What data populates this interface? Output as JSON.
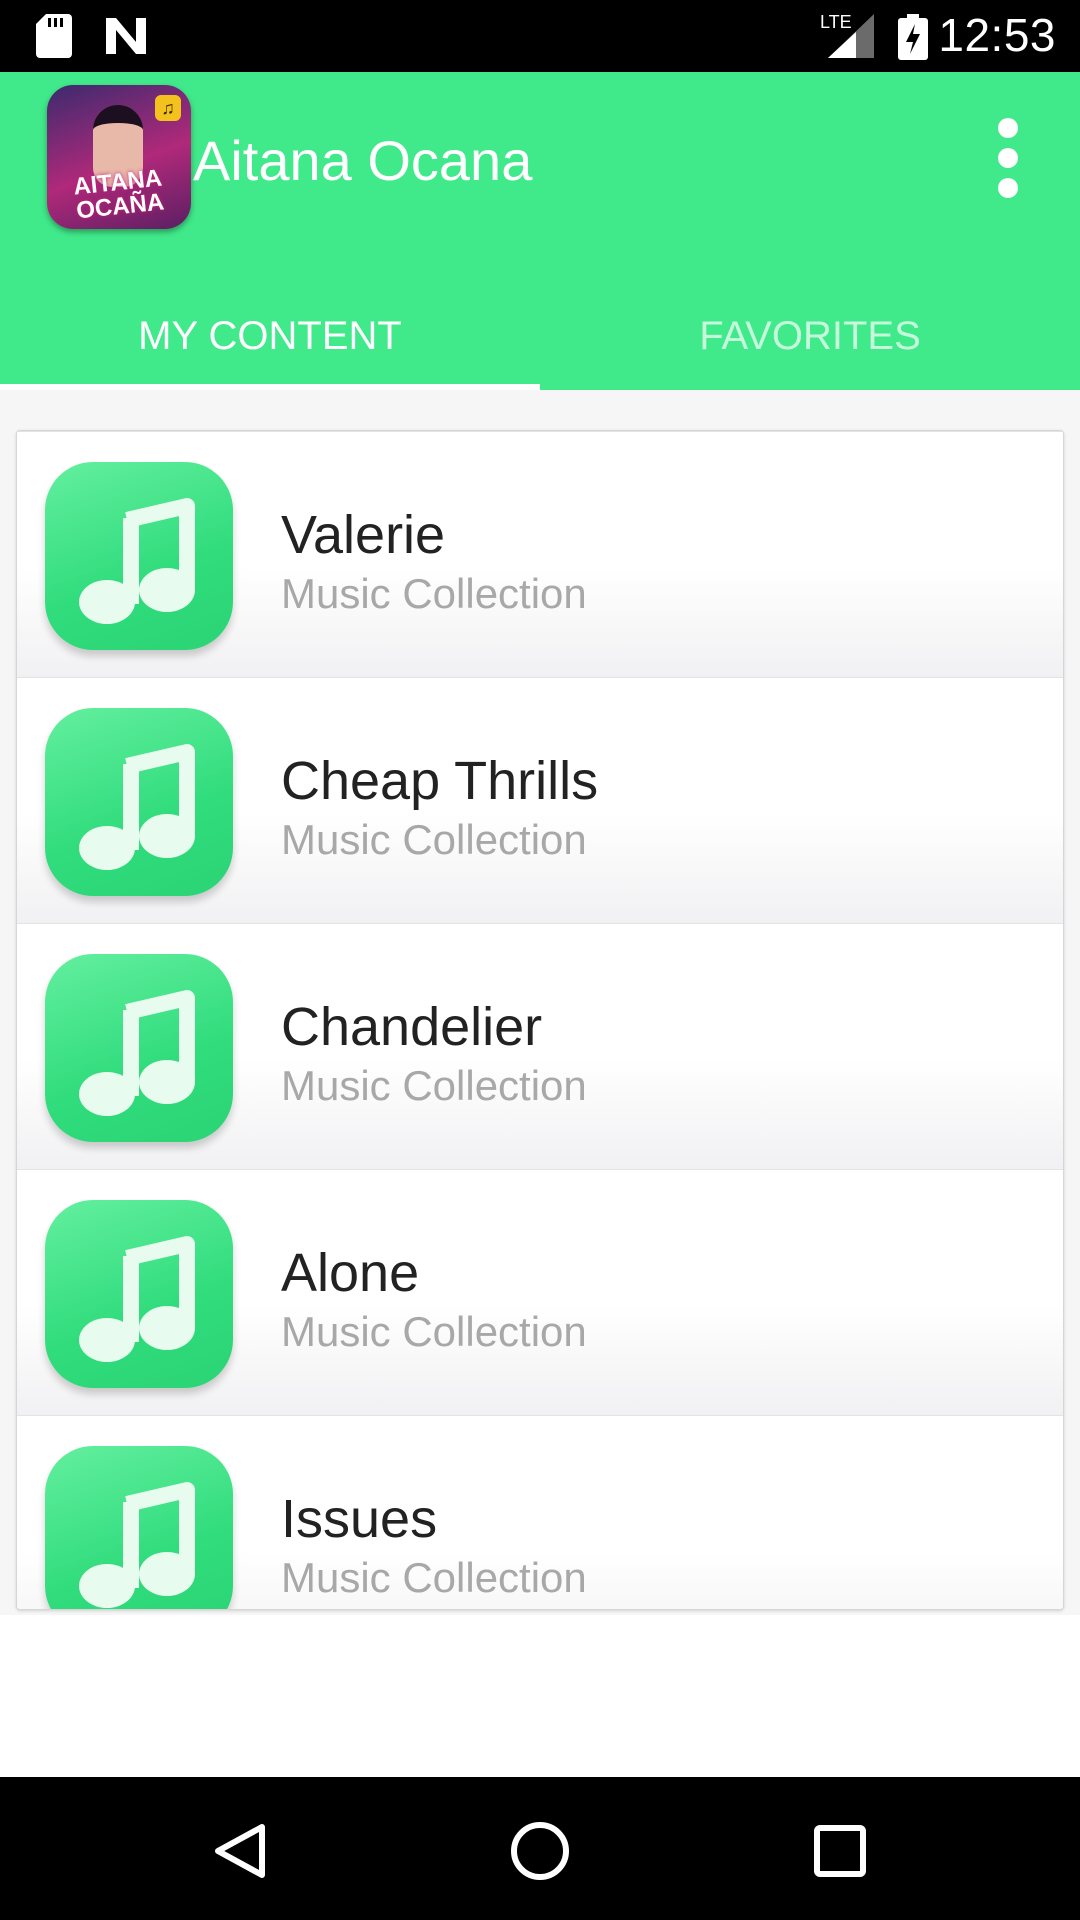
{
  "status_bar": {
    "time": "12:53",
    "network_label": "LTE",
    "icons": [
      "sd-card-icon",
      "n-notification-icon",
      "lte-signal-icon",
      "battery-charging-icon"
    ]
  },
  "app_bar": {
    "title": "Aitana Ocana",
    "logo_text": "AITANA OCAÑA",
    "menu_icon": "more-vert-icon",
    "color": "#40e98a"
  },
  "tabs": [
    {
      "label": "MY CONTENT",
      "selected": true
    },
    {
      "label": "FAVORITES",
      "selected": false
    }
  ],
  "songs": [
    {
      "title": "Valerie",
      "subtitle": "Music Collection",
      "icon": "music-note-icon"
    },
    {
      "title": "Cheap Thrills",
      "subtitle": "Music Collection",
      "icon": "music-note-icon"
    },
    {
      "title": "Chandelier",
      "subtitle": "Music Collection",
      "icon": "music-note-icon"
    },
    {
      "title": "Alone",
      "subtitle": "Music Collection",
      "icon": "music-note-icon"
    },
    {
      "title": "Issues",
      "subtitle": "Music Collection",
      "icon": "music-note-icon"
    }
  ],
  "nav_bar": {
    "buttons": [
      "back-icon",
      "home-icon",
      "recents-icon"
    ]
  }
}
